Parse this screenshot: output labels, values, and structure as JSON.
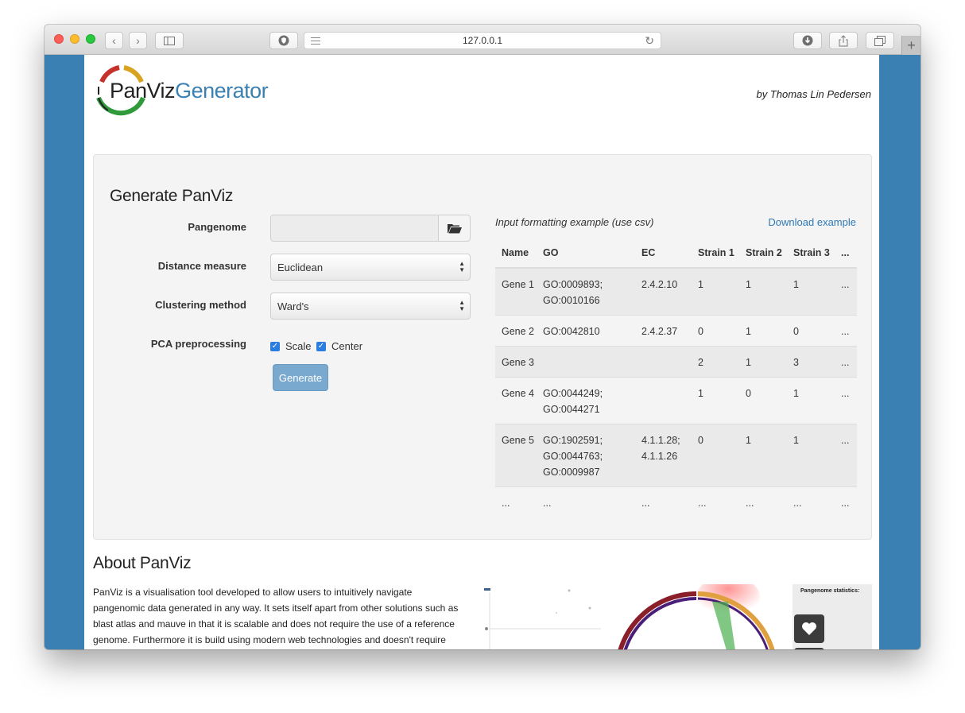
{
  "browser": {
    "url": "127.0.0.1"
  },
  "header": {
    "logo_part1": "PanViz",
    "logo_part2": "Generator",
    "author": "by Thomas Lin Pedersen"
  },
  "form": {
    "title": "Generate PanViz",
    "pangenome_label": "Pangenome",
    "pangenome_value": "",
    "distance_label": "Distance measure",
    "distance_value": "Euclidean",
    "clustering_label": "Clustering method",
    "clustering_value": "Ward's",
    "pca_label": "PCA preprocessing",
    "scale_label": "Scale",
    "scale_checked": true,
    "center_label": "Center",
    "center_checked": true,
    "generate_label": "Generate"
  },
  "example": {
    "title": "Input formatting example (use csv)",
    "download_label": "Download example",
    "headers": [
      "Name",
      "GO",
      "EC",
      "Strain 1",
      "Strain 2",
      "Strain 3",
      "..."
    ],
    "rows": [
      [
        "Gene 1",
        "GO:0009893; GO:0010166",
        "2.4.2.10",
        "1",
        "1",
        "1",
        "..."
      ],
      [
        "Gene 2",
        "GO:0042810",
        "2.4.2.37",
        "0",
        "1",
        "0",
        "..."
      ],
      [
        "Gene 3",
        "",
        "",
        "2",
        "1",
        "3",
        "..."
      ],
      [
        "Gene 4",
        "GO:0044249; GO:0044271",
        "",
        "1",
        "0",
        "1",
        "..."
      ],
      [
        "Gene 5",
        "GO:1902591; GO:0044763; GO:0009987",
        "4.1.1.28; 4.1.1.26",
        "0",
        "1",
        "1",
        "..."
      ],
      [
        "...",
        "...",
        "...",
        "...",
        "...",
        "...",
        "..."
      ]
    ]
  },
  "about": {
    "title": "About PanViz",
    "text": "PanViz is a visualisation tool developed to allow users to intuitively navigate pangenomic data generated in any way. It sets itself apart from other solutions such as blast atlas and mauve in that it is scalable and does not require the use of a reference genome. Furthermore it is build using modern web technologies and doesn't require installation of any software (safe for a",
    "stats_title": "Pangenome statistics:"
  },
  "colors": {
    "page_bg": "#3a80b2",
    "accent": "#2f79b6",
    "button": "#7aa9d0"
  }
}
